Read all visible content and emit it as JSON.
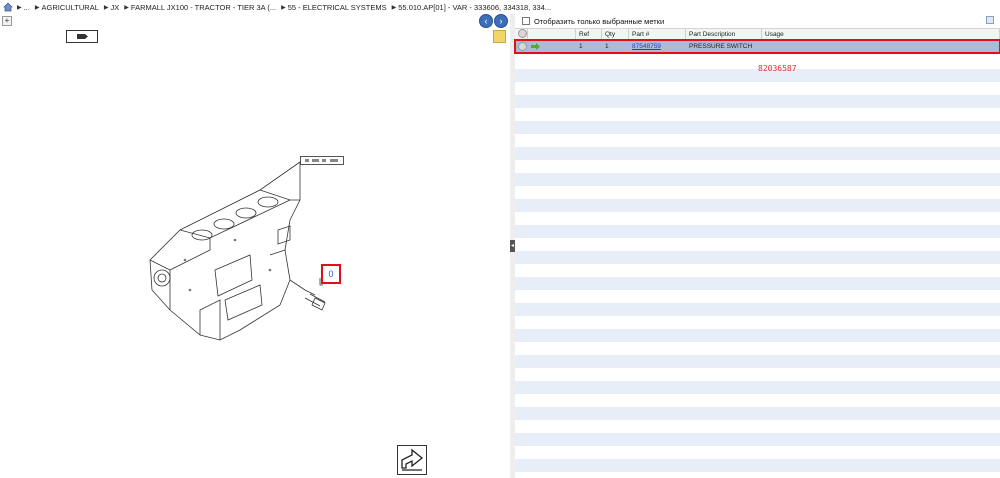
{
  "breadcrumb": {
    "items": [
      "...",
      "AGRICULTURAL",
      "JX",
      "FARMALL JX100 - TRACTOR - TIER 3A (...",
      "55 - ELECTRICAL SYSTEMS",
      "55.010.AP[01] - VAR - 333606, 334318, 334..."
    ]
  },
  "left": {
    "callout_number": "0"
  },
  "right": {
    "filter_label": "Отобразить только выбранные метки",
    "columns": [
      "",
      "",
      "Ref",
      "Qty",
      "Part #",
      "Part Description",
      "Usage"
    ],
    "rows": [
      {
        "ref": "1",
        "qty": "1",
        "part_no": "87548759",
        "description": "PRESSURE SWITCH",
        "usage": ""
      }
    ],
    "reference_number": "82036587"
  },
  "colors": {
    "accent": "#3d6fb8",
    "selection": "#a9bdd6",
    "highlight": "#e0101a",
    "stripe": "#e8eef7"
  },
  "icons": [
    "home-icon",
    "back-arrow-icon",
    "forward-arrow-icon",
    "tag-icon",
    "note-icon",
    "export-icon",
    "info-icon",
    "green-arrow-icon"
  ]
}
